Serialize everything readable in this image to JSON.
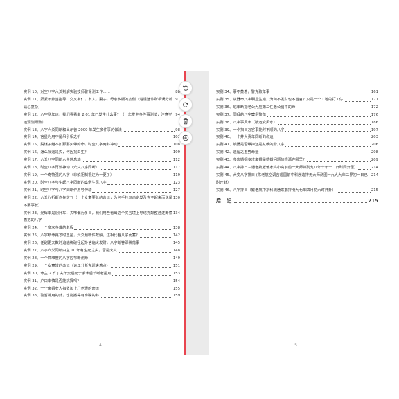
{
  "left_page": {
    "page_number": "4",
    "entries": [
      {
        "title": "实例 10、对空八字六爻判解实验技师警惕测工作……",
        "page": "88"
      },
      {
        "title": "实例 11、肝紧不卦当指导，交叉串仁，本人，妻子，母亲多版的案例（进退迷诊所相误分析请心复杂）",
        "page": "91"
      },
      {
        "title": "实例 12、八字测年运，我们看看由 2 01 年已发生什么事？（一年发生多件事测法，注意岁运预测细致）",
        "page": "94"
      },
      {
        "title": "实例 13、八字六爻同断和出示曾 2000 年发生多件事的做法",
        "page": "98"
      },
      {
        "title": "实例 14、官星为用不是吊引相之祈",
        "page": "103"
      },
      {
        "title": "实例 15、脱煤子继不如那那久带的命，时空八字两卦冲动",
        "page": "108"
      },
      {
        "title": "实例 16、怎么找运是失，何因找由生？",
        "page": "109"
      },
      {
        "title": "实例 17、六爻八字同断六亲冲息动",
        "page": "112"
      },
      {
        "title": "实例 18、时空八字再谈神动（六爻八字同断）",
        "page": "117"
      },
      {
        "title": "实例 19、一个奇特强的八字（非蜕祀制根还为一更子）",
        "page": "119"
      },
      {
        "title": "实例 20、时空八字与生起八字同断的案例生尽八字",
        "page": "123"
      },
      {
        "title": "实例 21、时空八字与八字同断作用导神动",
        "page": "127"
      },
      {
        "title": "实例 22、六爻九折断作先定气（一个女童要长的命运，为何手抄马凶定发及克主起来而说是不要事长）",
        "page": "130"
      },
      {
        "title": "实例 23、光辉本是阴升车，夫唯偏为多日，我们用些看出这个实五境上导塔克颠整还还断镜着范的八字",
        "page": "134"
      },
      {
        "title": "实例 24、一个多次多难的老板",
        "page": "138"
      },
      {
        "title": "实例 25、八字断命英才时里星，六爻预断件数解，达相比看八字而蓄？",
        "page": "142"
      },
      {
        "title": "实例 26、任甜更天数时追临绑破径起冬信临义发财，八字断答即稀落事",
        "page": "145"
      },
      {
        "title": "实例 27、八字六爻同断由主 1L 年有生死之头，否是火火",
        "page": "148"
      },
      {
        "title": "实例 28、一个高难度的八字应节断测命",
        "page": "149"
      },
      {
        "title": "实例 29、一个女童较的命运（读年分析克遗夫着点）",
        "page": "151"
      },
      {
        "title": "实例 30、命主 2 岁丁夫年交后死于手术后节断老星点",
        "page": "153"
      },
      {
        "title": "实例 31、户口本慎是否能挑择吗？",
        "page": "154"
      },
      {
        "title": "实例 32、一个离婚女人指数加上广老板的命运",
        "page": "155"
      },
      {
        "title": "实例 33、警暂排用的卦，也能搬得有准确的卦",
        "page": "159"
      }
    ]
  },
  "right_page": {
    "page_number": "5",
    "entries": [
      {
        "title": "实例 34、事不蒸着，警克致年事",
        "page": "161"
      },
      {
        "title": "实例 35、从器命八字明显生错，为何不发财也不当官？只是一个工地的打工仔",
        "page": "171"
      },
      {
        "title": "实例 36、昭年断指老公为应第二任老公脑平的命",
        "page": "172"
      },
      {
        "title": "实例 37、同拜的八字案例警落",
        "page": "176"
      },
      {
        "title": "实例 38、八字事风水（破运变风水）",
        "page": "186"
      },
      {
        "title": "实例 39、一个扫日万官事能时不顺的八字",
        "page": "197"
      },
      {
        "title": "实例 40、一个并大责年同断的命运",
        "page": "203"
      },
      {
        "title": "实例 41、婉蔓是否维持还是从维的脉八字",
        "page": "206"
      },
      {
        "title": "实例 42、遗留之五势命运",
        "page": "208"
      },
      {
        "title": "实例 43、多次婚姻多次离婚是婚婚问题的根源在哪里？",
        "page": "209"
      },
      {
        "title": "实例 44、八字排日三通老航老偏家终小高前前一大师排列九八年十年十二日时同开居）",
        "page": "214"
      },
      {
        "title": "实例 45、大变八字排日 (陈老航空调吉遇国前中科序造排无大师测图一九九九年二界初一日已时开卦）",
        "page": "214"
      },
      {
        "title": "实例 46、八字排日（繁老航中京科疏通来筋排明九七年四月初六时开卦）",
        "page": "215"
      }
    ],
    "afterword": {
      "label": "后 记",
      "page": "215"
    }
  },
  "toolbar": {
    "buttons": [
      {
        "name": "rotate-left-button",
        "icon": "rotate-left-icon"
      },
      {
        "name": "rotate-right-button",
        "icon": "rotate-right-icon"
      },
      {
        "name": "delete-button",
        "icon": "trash-icon"
      },
      {
        "name": "insert-button",
        "icon": "plus-circle-icon"
      }
    ]
  },
  "colors": {
    "insert_line": "#e8454f",
    "gap_background": "#ebebeb"
  }
}
